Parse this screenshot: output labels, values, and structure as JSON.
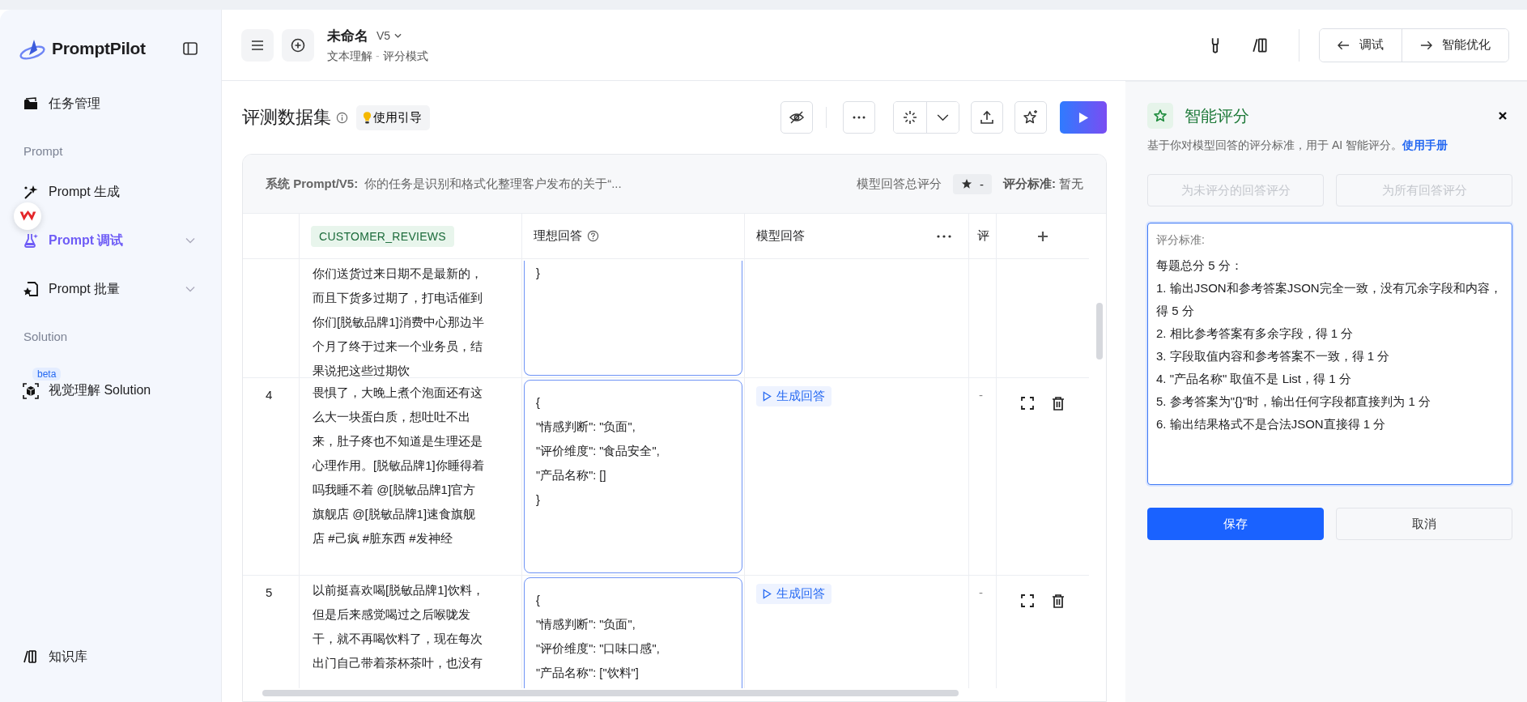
{
  "sidebar": {
    "brand": "PromptPilot",
    "entries": [
      {
        "kind": "item",
        "label": "任务管理",
        "selected": false
      },
      {
        "kind": "section",
        "label": "Prompt"
      },
      {
        "kind": "item",
        "label": "Prompt 生成",
        "selected": false
      },
      {
        "kind": "item",
        "label": "Prompt 调试",
        "selected": true,
        "expanded": false
      },
      {
        "kind": "item",
        "label": "Prompt 批量",
        "selected": false,
        "expanded": false
      },
      {
        "kind": "section",
        "label": "Solution"
      },
      {
        "kind": "item",
        "label": "视觉理解 Solution",
        "selected": false,
        "badge": "beta"
      }
    ],
    "footer": "知识库"
  },
  "header": {
    "title": "未命名",
    "version": "V5",
    "subtitle_task": "文本理解",
    "subtitle_sep": "-",
    "subtitle_mode": "评分模式",
    "actions": [
      "调试",
      "智能优化"
    ]
  },
  "dataset": {
    "title": "评测数据集",
    "guide": "使用引导"
  },
  "info": {
    "prompt_label": "系统 Prompt/V5:",
    "prompt_text": "你的任务是识别和格式化整理客户发布的关于“...",
    "total_label": "模型回答总评分",
    "total_value": "-",
    "criteria_label": "评分标准:",
    "criteria_value": "暂无"
  },
  "table": {
    "columns": [
      {
        "label": "CUSTOMER_REVIEWS"
      },
      {
        "label": "理想回答"
      },
      {
        "label": "模型回答"
      },
      {
        "label": "评"
      }
    ],
    "rows": [
      {
        "review": "你们送货过来日期不是最新的，而且下货多过期了，打电话催到你们[脱敏品牌1]消费中心那边半个月了终于过来一个业务员，结果说把这些过期饮",
        "ideal": "}"
      },
      {
        "index": "4",
        "review": "畏惧了，大晚上煮个泡面还有这么大一块蛋白质，想吐吐不出来，肚子疼也不知道是生理还是心理作用。[脱敏品牌1]你睡得着吗我睡不着 @[脱敏品牌1]官方旗舰店 @[脱敏品牌1]速食旗舰店 #己疯 #脏东西 #发神经",
        "ideal": "{\n\"情感判断\": \"负面\",\n\"评价维度\": \"食品安全\",\n\"产品名称\": []\n}",
        "action": "生成回答",
        "score": "-"
      },
      {
        "index": "5",
        "review": "以前挺喜欢喝[脱敏品牌1]饮料，但是后来感觉喝过之后喉咙发干，就不再喝饮料了，现在每次出门自己带着茶杯茶叶，也没有",
        "ideal": "{\n\"情感判断\": \"负面\",\n\"评价维度\": \"口味口感\",\n\"产品名称\": [\"饮料\"]",
        "action": "生成回答",
        "score": "-"
      }
    ]
  },
  "panel": {
    "title": "智能评分",
    "desc": "基于你对模型回答的评分标准，用于 AI 智能评分。",
    "link": "使用手册",
    "buttons": [
      {
        "label": "为未评分的回答评分",
        "disabled": true
      },
      {
        "label": "为所有回答评分",
        "disabled": true
      }
    ],
    "criteria_label": "评分标准:",
    "criteria": "每题总分 5 分：\n1. 输出JSON和参考答案JSON完全一致，没有冗余字段和内容，得 5 分\n2. 相比参考答案有多余字段，得 1 分\n3. 字段取值内容和参考答案不一致，得 1 分\n4. \"产品名称\" 取值不是 List，得 1 分\n5. 参考答案为\"{}\"时，输出任何字段都直接判为 1 分\n6. 输出结果格式不是合法JSON直接得 1 分",
    "save": "保存",
    "cancel": "取消"
  }
}
